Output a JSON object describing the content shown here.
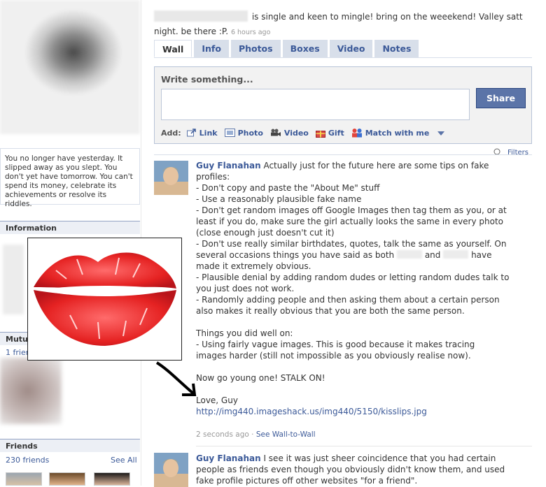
{
  "status": {
    "text": "is single and keen to mingle! bring on the weeekend! Valley satt night. be there :P.",
    "time": "6 hours ago"
  },
  "tabs": [
    {
      "label": "Wall",
      "active": true
    },
    {
      "label": "Info"
    },
    {
      "label": "Photos"
    },
    {
      "label": "Boxes"
    },
    {
      "label": "Video"
    },
    {
      "label": "Notes"
    }
  ],
  "publisher": {
    "label": "Write something...",
    "input_value": "",
    "share_label": "Share",
    "add_label": "Add:",
    "add_items": [
      {
        "label": "Link",
        "icon": "link-icon"
      },
      {
        "label": "Photo",
        "icon": "photo-icon"
      },
      {
        "label": "Video",
        "icon": "video-camera-icon"
      },
      {
        "label": "Gift",
        "icon": "gift-icon"
      },
      {
        "label": "Match with me",
        "icon": "match-people-icon"
      }
    ]
  },
  "filters_label": "Filters",
  "sidebar": {
    "quote": "You no longer have yesterday. It slipped away as you slept. You don't yet have tomorrow. You can't spend its money, celebrate its achievements or resolve its riddles.",
    "information_header": "Information",
    "mutual_header": "Mutual",
    "mutual_count": "1 frien",
    "friends_header": "Friends",
    "friends_count": "230 friends",
    "see_all": "See All"
  },
  "post1": {
    "author": "Guy Flanahan",
    "intro": "Actually just for the future here are some tips on fake",
    "l1": "profiles:",
    "l2": "- Don't copy and paste the \"About Me\" stuff",
    "l3": "- Use a reasonably plausible fake name",
    "l4": "- Don't get random images off Google Images then tag them as you, or at",
    "l5": "least if you do, make sure the girl actually looks the same in every photo",
    "l6": "(close enough just doesn't cut it)",
    "l7": "- Don't use really similar birthdates, quotes, talk the same as yourself. On",
    "l8a": "several occasions things you have said as both",
    "l8b": "and",
    "l8c": "have",
    "l9": "made it extremely obvious.",
    "l10": "- Plausible denial by adding random dudes or letting random dudes talk to",
    "l11": "you just does not work.",
    "l12": "- Randomly adding people and then asking them about a certain person",
    "l13": "also makes it really obvious that you are both the same person.",
    "l14": "Things you did well on:",
    "l15": "- Using fairly vague images. This is good because it makes tracing",
    "l16": "images harder (still not impossible as you obviously realise now).",
    "l17": "Now go young one! STALK ON!",
    "l18": "Love, Guy",
    "link": "http://img440.imageshack.us/img440/5150/kisslips.jpg",
    "time": "2 seconds ago",
    "sep": "·",
    "wall_to_wall": "See Wall-to-Wall"
  },
  "post2": {
    "author": "Guy Flanahan",
    "l1": "I see it was just sheer coincidence that you had certain",
    "l2": "people as friends even though you obviously didn't know them, and used",
    "l3": "fake profile pictures off other websites \"for a friend\"."
  }
}
